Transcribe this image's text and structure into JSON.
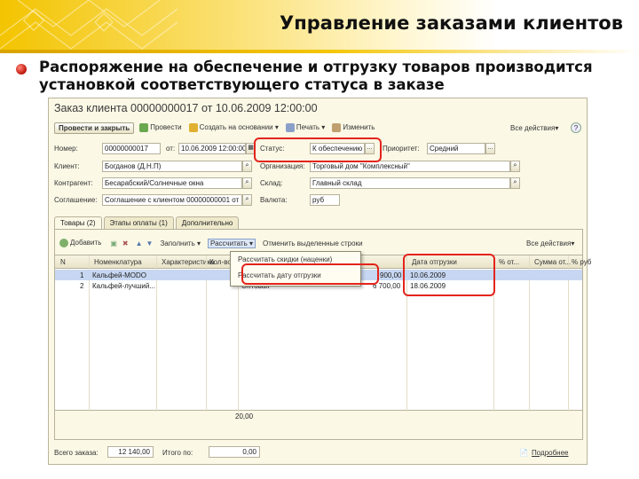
{
  "slide": {
    "title": "Управление заказами клиентов",
    "text": "Распоряжение на обеспечение и отгрузку товаров производится установкой соответствующего статуса в заказе"
  },
  "window": {
    "title": "Заказ клиента 00000000017 от 10.06.2009 12:00:00",
    "toolbar": {
      "post_close": "Провести и закрыть",
      "post": "Провести",
      "create_base": "Создать на основании",
      "print": "Печать",
      "edit": "Изменить",
      "all_actions": "Все действия",
      "help": "?"
    },
    "fields": {
      "number_label": "Номер:",
      "number_value": "00000000017",
      "date_label": "от:",
      "date_value": "10.06.2009 12:00:00",
      "status_label": "Статус:",
      "status_value": "К обеспечению",
      "priority_label": "Приоритет:",
      "priority_value": "Средний",
      "client_label": "Клиент:",
      "client_value": "Богданов (Д.Н.П)",
      "organization_label": "Организация:",
      "organization_value": "Торговый дом \"Комплексный\"",
      "contact_label": "Контрагент:",
      "contact_value": "Бесарабский/Солнечные окна",
      "warehouse_label": "Склад:",
      "warehouse_value": "Главный склад",
      "agreement_label": "Соглашение:",
      "agreement_value": "Соглашение с клиентом 00000000001 от",
      "currency_label": "Валюта:",
      "currency_value": "руб"
    },
    "tabs": [
      "Товары (2)",
      "Этапы оплаты (1)",
      "Дополнительно"
    ],
    "grid_toolbar": {
      "add": "Добавить",
      "fill": "Заполнить",
      "calculate": "Рассчитать",
      "mark_rows": "Отменить выделенные строки",
      "all_actions": "Все действия"
    },
    "dropdown": {
      "item1": "Рассчитать скидки (наценки)",
      "item2": "Рассчитать дату отгрузки"
    },
    "grid": {
      "headers": [
        "N",
        "Номенклатура",
        "Характеристика",
        "Кол-во",
        "Дата отгрузки",
        "% от...",
        "Сумма от...",
        "% руб"
      ],
      "rows": [
        {
          "n": "1",
          "name": "Кальфей-MODO",
          "price_frag": "900,00",
          "date": "10.06.2009"
        },
        {
          "n": "2",
          "name": "Кальфей-лучший...",
          "type": "Оптовая",
          "price_frag": "6 700,00",
          "date": "18.06.2009"
        }
      ],
      "total": "20,00"
    },
    "footer": {
      "total_label": "Всего заказа:",
      "total_value": "12 140,00",
      "in_label": "Итого по:",
      "in_value": "0,00",
      "more_link": "Подробнее"
    }
  },
  "colors": {
    "accent": "#e3241b",
    "header_yellow": "#f3c400"
  }
}
